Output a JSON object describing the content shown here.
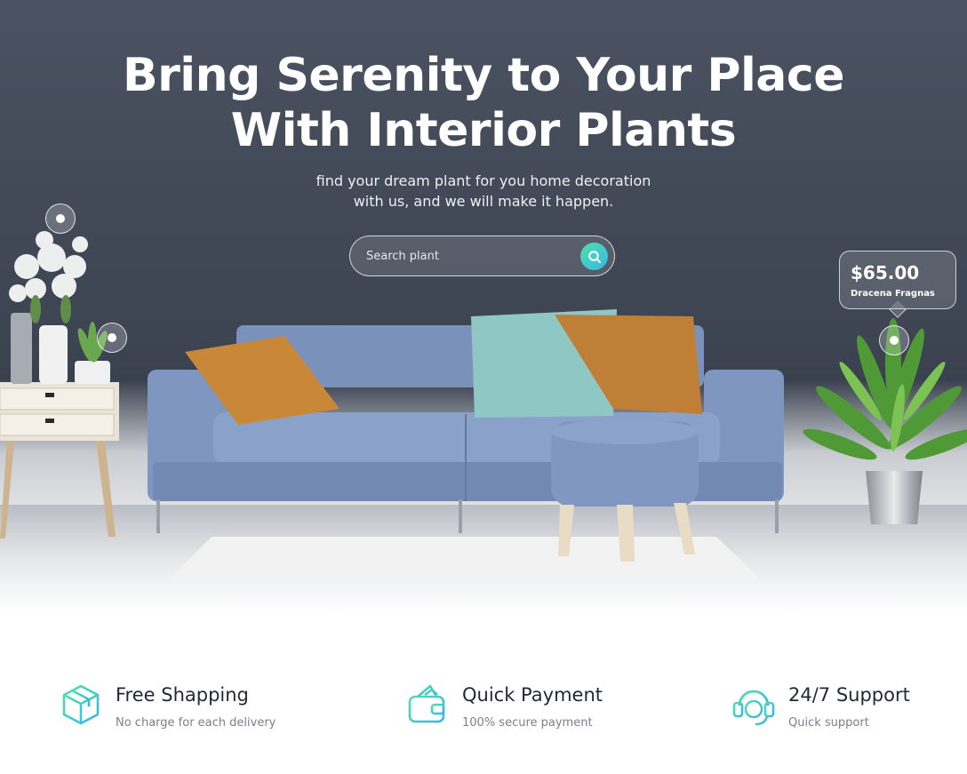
{
  "hero": {
    "title_line1": "Bring Serenity to Your Place",
    "title_line2": "With Interior Plants",
    "subtitle_line1": "find your dream plant for you home decoration",
    "subtitle_line2": "with us, and we will make it happen.",
    "search": {
      "placeholder": "Search plant",
      "button_icon": "search-icon"
    },
    "price_card": {
      "price": "$65.00",
      "name": "Dracena Fragnas"
    }
  },
  "colors": {
    "accent_gradient_start": "#4fe0a8",
    "accent_gradient_end": "#36b6e8",
    "hero_wall": "#434b59",
    "sofa": "#7c93bd"
  },
  "features": [
    {
      "icon": "box-icon",
      "title": "Free Shapping",
      "desc": "No charge for each delivery"
    },
    {
      "icon": "wallet-icon",
      "title": "Quick Payment",
      "desc": "100% secure payment"
    },
    {
      "icon": "headset-icon",
      "title": "24/7 Support",
      "desc": "Quick support"
    }
  ]
}
